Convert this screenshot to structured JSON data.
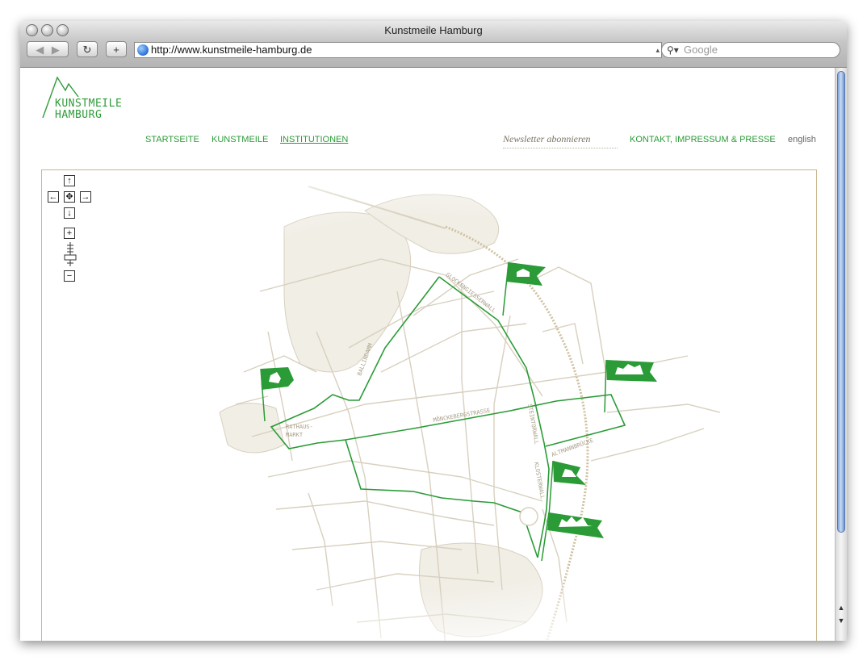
{
  "window": {
    "title": "Kunstmeile Hamburg",
    "url": "http://www.kunstmeile-hamburg.de",
    "search_placeholder": "Google",
    "back_icon": "back-arrow-icon",
    "forward_icon": "forward-arrow-icon",
    "reload_label": "↻",
    "add_label": "+"
  },
  "logo": {
    "line1": "KUNSTMEILE",
    "line2": "HAMBURG"
  },
  "nav": {
    "items": [
      {
        "label": "STARTSEITE",
        "active": false
      },
      {
        "label": "KUNSTMEILE",
        "active": false
      },
      {
        "label": "INSTITUTIONEN",
        "active": true
      }
    ],
    "newsletter": "Newsletter abonnieren",
    "contact": "KONTAKT, IMPRESSUM & PRESSE",
    "language": "english"
  },
  "map": {
    "street_labels": [
      "GLOCKENGIESSERWALL",
      "BALLINDAMM",
      "MÖNCKEBERGSTRASSE",
      "STEINTORWALL",
      "RATHAUS-",
      "MARKT",
      "ALTMANNBRÜCKE",
      "KLOSTERWALL"
    ],
    "controls": {
      "pan_up": "↑",
      "pan_left": "←",
      "pan_center": "✥",
      "pan_right": "→",
      "pan_down": "↓",
      "zoom_in": "+",
      "zoom_out": "−"
    }
  },
  "colors": {
    "brand_green": "#2a9b36",
    "map_beige": "#d8d0bf",
    "frame": "#c9b68d"
  }
}
